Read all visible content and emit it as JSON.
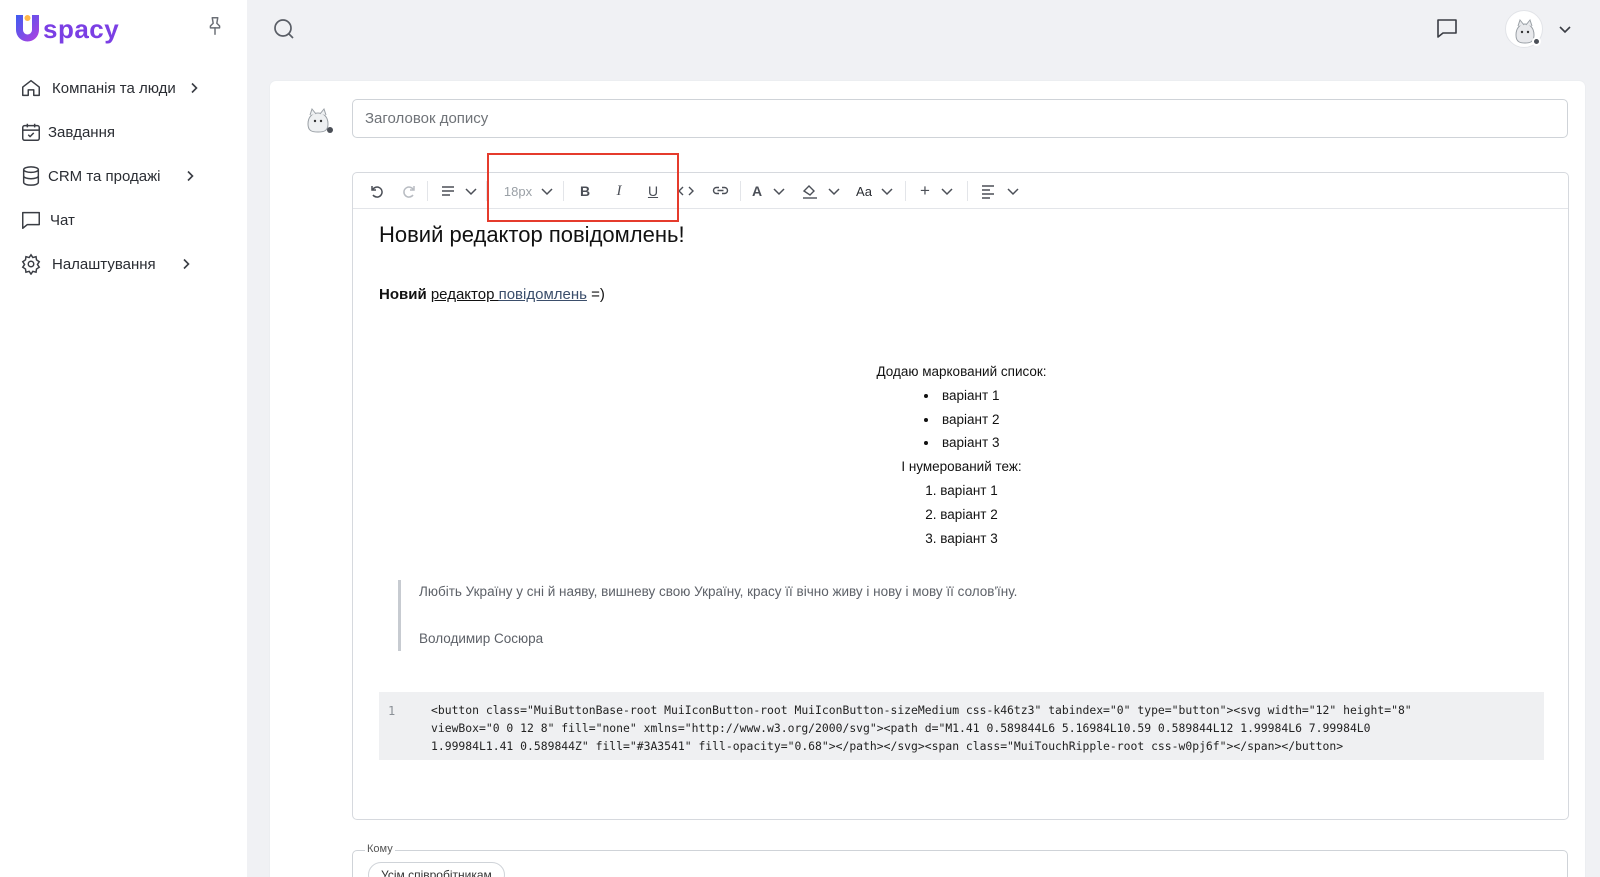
{
  "app": {
    "logo_text": "spacy",
    "brand_color": "#7b3fe4"
  },
  "sidebar": {
    "items": [
      {
        "label": "Компанія та люди",
        "icon": "home-icon",
        "has_children": true
      },
      {
        "label": "Завдання",
        "icon": "calendar-icon",
        "has_children": false
      },
      {
        "label": "CRM та продажі",
        "icon": "database-icon",
        "has_children": true
      },
      {
        "label": "Чат",
        "icon": "chat-icon",
        "has_children": false
      },
      {
        "label": "Налаштування",
        "icon": "gear-icon",
        "has_children": true
      }
    ]
  },
  "post": {
    "title_placeholder": "Заголовок допису",
    "toolbar": {
      "font_size": "18px",
      "bold": "B",
      "italic": "I",
      "underline": "U",
      "font_color": "A",
      "text_case": "Aa",
      "insert": "+"
    },
    "highlight_color": "#e53b2c",
    "body": {
      "heading": "Новий редактор повідомлень!",
      "para_bold": "Новий",
      "para_underline": "редактор ",
      "para_link": "повідомлень",
      "para_tail": " =)",
      "bullet_intro": "Додаю маркований список:",
      "bullets": [
        "варіант 1",
        "варіант 2",
        "варіант 3"
      ],
      "numbered_intro": "І нумерований теж:",
      "numbered": [
        "варіант 1",
        "варіант 2",
        "варіант 3"
      ],
      "quote_text": "Любіть Україну у сні й наяву, вишневу свою Україну, красу її вічно живу і нову і мову її солов'їну.",
      "quote_author": "Володимир Сосюра",
      "code_line_number": "1",
      "code_lines": [
        "<button class=\"MuiButtonBase-root MuiIconButton-root MuiIconButton-sizeMedium css-k46tz3\" tabindex=\"0\" type=\"button\"><svg width=\"12\" height=\"8\"",
        "viewBox=\"0 0 12 8\" fill=\"none\" xmlns=\"http://www.w3.org/2000/svg\"><path d=\"M1.41 0.589844L6 5.16984L10.59 0.589844L12 1.99984L6 7.99984L0",
        "1.99984L1.41 0.589844Z\" fill=\"#3A3541\" fill-opacity=\"0.68\"></path></svg><span class=\"MuiTouchRipple-root css-w0pj6f\"></span></button>"
      ]
    },
    "to_label": "Кому",
    "to_chip": "Усім співробітникам"
  }
}
